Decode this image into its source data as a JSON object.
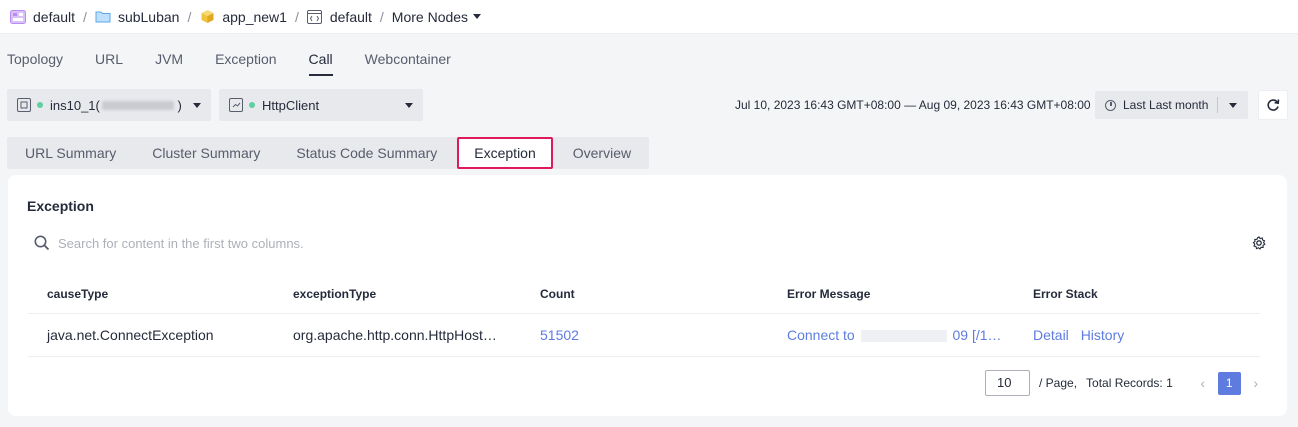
{
  "breadcrumb": [
    {
      "label": "default",
      "icon": "application-group-icon",
      "color": "#b88cf0"
    },
    {
      "label": "subLuban",
      "icon": "folder-icon",
      "color": "#5ea7e8"
    },
    {
      "label": "app_new1",
      "icon": "cube-icon",
      "color": "#f0c43a"
    },
    {
      "label": "default",
      "icon": "code-window-icon",
      "color": "#575d6c"
    }
  ],
  "breadcrumb_more": "More Nodes",
  "top_tabs": [
    "Topology",
    "URL",
    "JVM",
    "Exception",
    "Call",
    "Webcontainer"
  ],
  "top_tab_active": "Call",
  "instance_select": {
    "value_prefix": "ins10_1(",
    "value_suffix": " )"
  },
  "call_select": {
    "value": "HttpClient"
  },
  "date_range": "Jul 10, 2023 16:43 GMT+08:00 — Aug 09, 2023 16:43 GMT+08:00",
  "period": "Last Last month",
  "sub_tabs": [
    "URL Summary",
    "Cluster Summary",
    "Status Code Summary",
    "Exception",
    "Overview"
  ],
  "sub_tab_active": "Exception",
  "card": {
    "title": "Exception",
    "search_placeholder": "Search for content in the first two columns."
  },
  "table": {
    "headers": [
      "causeType",
      "exceptionType",
      "Count",
      "Error Message",
      "Error Stack"
    ],
    "rows": [
      {
        "causeType": "java.net.ConnectException",
        "exceptionType": "org.apache.http.conn.HttpHost…",
        "count": "51502",
        "error_message_prefix": "Connect to",
        "error_message_suffix": "09 [/1…",
        "detail": "Detail",
        "history": "History"
      }
    ]
  },
  "pagination": {
    "page_size": "10",
    "per_page_label": "/ Page,",
    "total_records": "Total Records: 1",
    "current_page": "1"
  },
  "colors": {
    "accent": "#5e7ce0",
    "highlight_border": "#e0195c",
    "status_green": "#5cd0a0"
  }
}
